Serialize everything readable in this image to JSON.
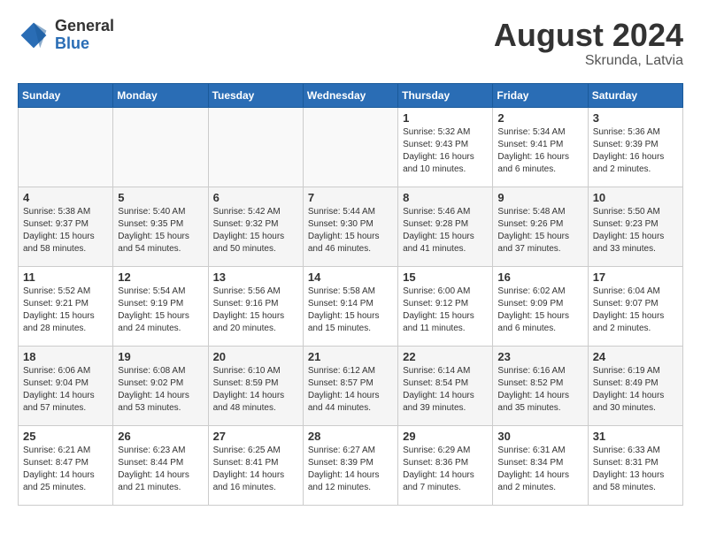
{
  "logo": {
    "general": "General",
    "blue": "Blue"
  },
  "title": {
    "month_year": "August 2024",
    "location": "Skrunda, Latvia"
  },
  "weekdays": [
    "Sunday",
    "Monday",
    "Tuesday",
    "Wednesday",
    "Thursday",
    "Friday",
    "Saturday"
  ],
  "weeks": [
    [
      {
        "day": "",
        "info": ""
      },
      {
        "day": "",
        "info": ""
      },
      {
        "day": "",
        "info": ""
      },
      {
        "day": "",
        "info": ""
      },
      {
        "day": "1",
        "info": "Sunrise: 5:32 AM\nSunset: 9:43 PM\nDaylight: 16 hours\nand 10 minutes."
      },
      {
        "day": "2",
        "info": "Sunrise: 5:34 AM\nSunset: 9:41 PM\nDaylight: 16 hours\nand 6 minutes."
      },
      {
        "day": "3",
        "info": "Sunrise: 5:36 AM\nSunset: 9:39 PM\nDaylight: 16 hours\nand 2 minutes."
      }
    ],
    [
      {
        "day": "4",
        "info": "Sunrise: 5:38 AM\nSunset: 9:37 PM\nDaylight: 15 hours\nand 58 minutes."
      },
      {
        "day": "5",
        "info": "Sunrise: 5:40 AM\nSunset: 9:35 PM\nDaylight: 15 hours\nand 54 minutes."
      },
      {
        "day": "6",
        "info": "Sunrise: 5:42 AM\nSunset: 9:32 PM\nDaylight: 15 hours\nand 50 minutes."
      },
      {
        "day": "7",
        "info": "Sunrise: 5:44 AM\nSunset: 9:30 PM\nDaylight: 15 hours\nand 46 minutes."
      },
      {
        "day": "8",
        "info": "Sunrise: 5:46 AM\nSunset: 9:28 PM\nDaylight: 15 hours\nand 41 minutes."
      },
      {
        "day": "9",
        "info": "Sunrise: 5:48 AM\nSunset: 9:26 PM\nDaylight: 15 hours\nand 37 minutes."
      },
      {
        "day": "10",
        "info": "Sunrise: 5:50 AM\nSunset: 9:23 PM\nDaylight: 15 hours\nand 33 minutes."
      }
    ],
    [
      {
        "day": "11",
        "info": "Sunrise: 5:52 AM\nSunset: 9:21 PM\nDaylight: 15 hours\nand 28 minutes."
      },
      {
        "day": "12",
        "info": "Sunrise: 5:54 AM\nSunset: 9:19 PM\nDaylight: 15 hours\nand 24 minutes."
      },
      {
        "day": "13",
        "info": "Sunrise: 5:56 AM\nSunset: 9:16 PM\nDaylight: 15 hours\nand 20 minutes."
      },
      {
        "day": "14",
        "info": "Sunrise: 5:58 AM\nSunset: 9:14 PM\nDaylight: 15 hours\nand 15 minutes."
      },
      {
        "day": "15",
        "info": "Sunrise: 6:00 AM\nSunset: 9:12 PM\nDaylight: 15 hours\nand 11 minutes."
      },
      {
        "day": "16",
        "info": "Sunrise: 6:02 AM\nSunset: 9:09 PM\nDaylight: 15 hours\nand 6 minutes."
      },
      {
        "day": "17",
        "info": "Sunrise: 6:04 AM\nSunset: 9:07 PM\nDaylight: 15 hours\nand 2 minutes."
      }
    ],
    [
      {
        "day": "18",
        "info": "Sunrise: 6:06 AM\nSunset: 9:04 PM\nDaylight: 14 hours\nand 57 minutes."
      },
      {
        "day": "19",
        "info": "Sunrise: 6:08 AM\nSunset: 9:02 PM\nDaylight: 14 hours\nand 53 minutes."
      },
      {
        "day": "20",
        "info": "Sunrise: 6:10 AM\nSunset: 8:59 PM\nDaylight: 14 hours\nand 48 minutes."
      },
      {
        "day": "21",
        "info": "Sunrise: 6:12 AM\nSunset: 8:57 PM\nDaylight: 14 hours\nand 44 minutes."
      },
      {
        "day": "22",
        "info": "Sunrise: 6:14 AM\nSunset: 8:54 PM\nDaylight: 14 hours\nand 39 minutes."
      },
      {
        "day": "23",
        "info": "Sunrise: 6:16 AM\nSunset: 8:52 PM\nDaylight: 14 hours\nand 35 minutes."
      },
      {
        "day": "24",
        "info": "Sunrise: 6:19 AM\nSunset: 8:49 PM\nDaylight: 14 hours\nand 30 minutes."
      }
    ],
    [
      {
        "day": "25",
        "info": "Sunrise: 6:21 AM\nSunset: 8:47 PM\nDaylight: 14 hours\nand 25 minutes."
      },
      {
        "day": "26",
        "info": "Sunrise: 6:23 AM\nSunset: 8:44 PM\nDaylight: 14 hours\nand 21 minutes."
      },
      {
        "day": "27",
        "info": "Sunrise: 6:25 AM\nSunset: 8:41 PM\nDaylight: 14 hours\nand 16 minutes."
      },
      {
        "day": "28",
        "info": "Sunrise: 6:27 AM\nSunset: 8:39 PM\nDaylight: 14 hours\nand 12 minutes."
      },
      {
        "day": "29",
        "info": "Sunrise: 6:29 AM\nSunset: 8:36 PM\nDaylight: 14 hours\nand 7 minutes."
      },
      {
        "day": "30",
        "info": "Sunrise: 6:31 AM\nSunset: 8:34 PM\nDaylight: 14 hours\nand 2 minutes."
      },
      {
        "day": "31",
        "info": "Sunrise: 6:33 AM\nSunset: 8:31 PM\nDaylight: 13 hours\nand 58 minutes."
      }
    ]
  ]
}
